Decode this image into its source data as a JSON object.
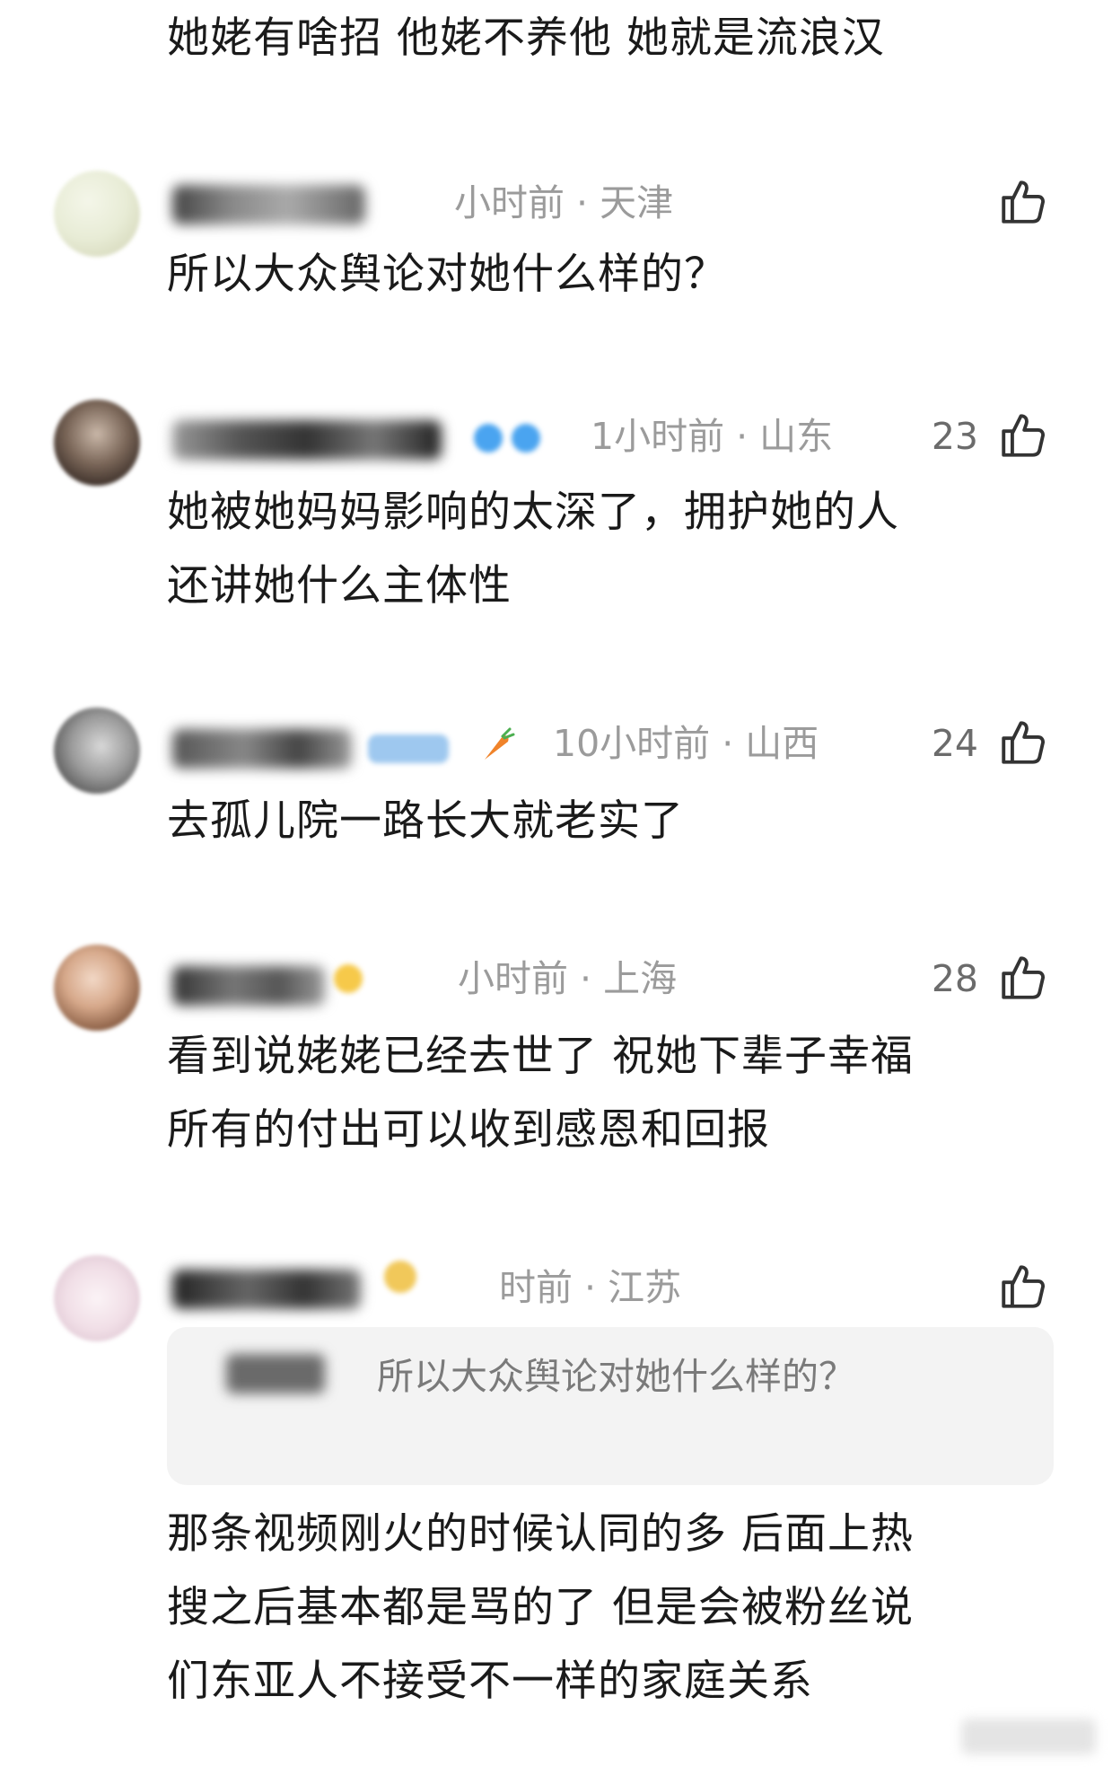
{
  "top_text": "她姥有啥招 他姥不养他 她就是流浪汉",
  "comments": [
    {
      "meta": "小时前 · 天津",
      "likes": "",
      "text": "所以大众舆论对她什么样的？"
    },
    {
      "meta": "1小时前 · 山东",
      "likes": "23",
      "text": "她被她妈妈影响的太深了，拥护她的人\n还讲她什么主体性"
    },
    {
      "meta": "10小时前 · 山西",
      "likes": "24",
      "text": "去孤儿院一路长大就老实了"
    },
    {
      "meta": "小时前 · 上海",
      "likes": "28",
      "text": "看到说姥姥已经去世了 祝她下辈子幸福\n所有的付出可以收到感恩和回报"
    },
    {
      "meta": "时前 · 江苏",
      "likes": "",
      "quote": "所以大众舆论对她什么样的？",
      "text": "那条视频刚火的时候认同的多 后面上热\n搜之后基本都是骂的了 但是会被粉丝说\n们东亚人不接受不一样的家庭关系"
    }
  ],
  "icons": {
    "like": "thumbs-up-icon",
    "carrot": "carrot-icon"
  }
}
